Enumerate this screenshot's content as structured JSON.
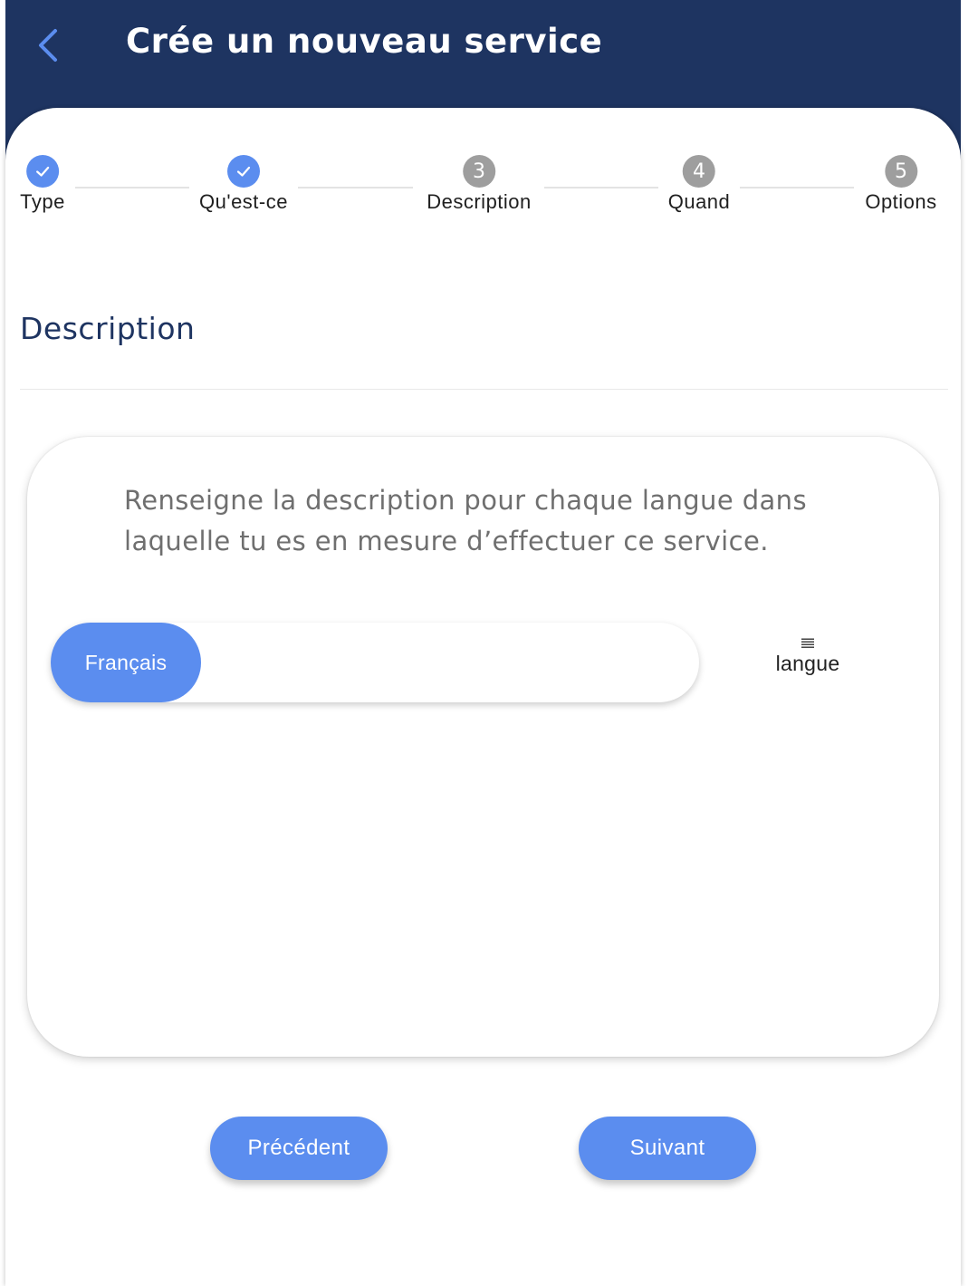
{
  "header": {
    "title": "Crée un nouveau service",
    "back_icon": "chevron-left-icon"
  },
  "colors": {
    "header_bg": "#1e3461",
    "accent": "#5b8def",
    "step_inactive": "#9e9e9e"
  },
  "stepper": {
    "steps": [
      {
        "label": "Type",
        "state": "done",
        "marker": ""
      },
      {
        "label": "Qu'est-ce",
        "state": "done",
        "marker": ""
      },
      {
        "label": "Description",
        "state": "todo",
        "marker": "3"
      },
      {
        "label": "Quand",
        "state": "todo",
        "marker": "4"
      },
      {
        "label": "Options",
        "state": "todo",
        "marker": "5"
      }
    ]
  },
  "section": {
    "title": "Description"
  },
  "card": {
    "instruction": "Renseigne la description pour chaque langue dans laquelle tu es en mesure d’effectuer ce service.",
    "languages": [
      "Français"
    ],
    "langue_button_label": "langue",
    "langue_icon": "menu-lines-icon"
  },
  "footer": {
    "previous_label": "Précédent",
    "next_label": "Suivant"
  }
}
